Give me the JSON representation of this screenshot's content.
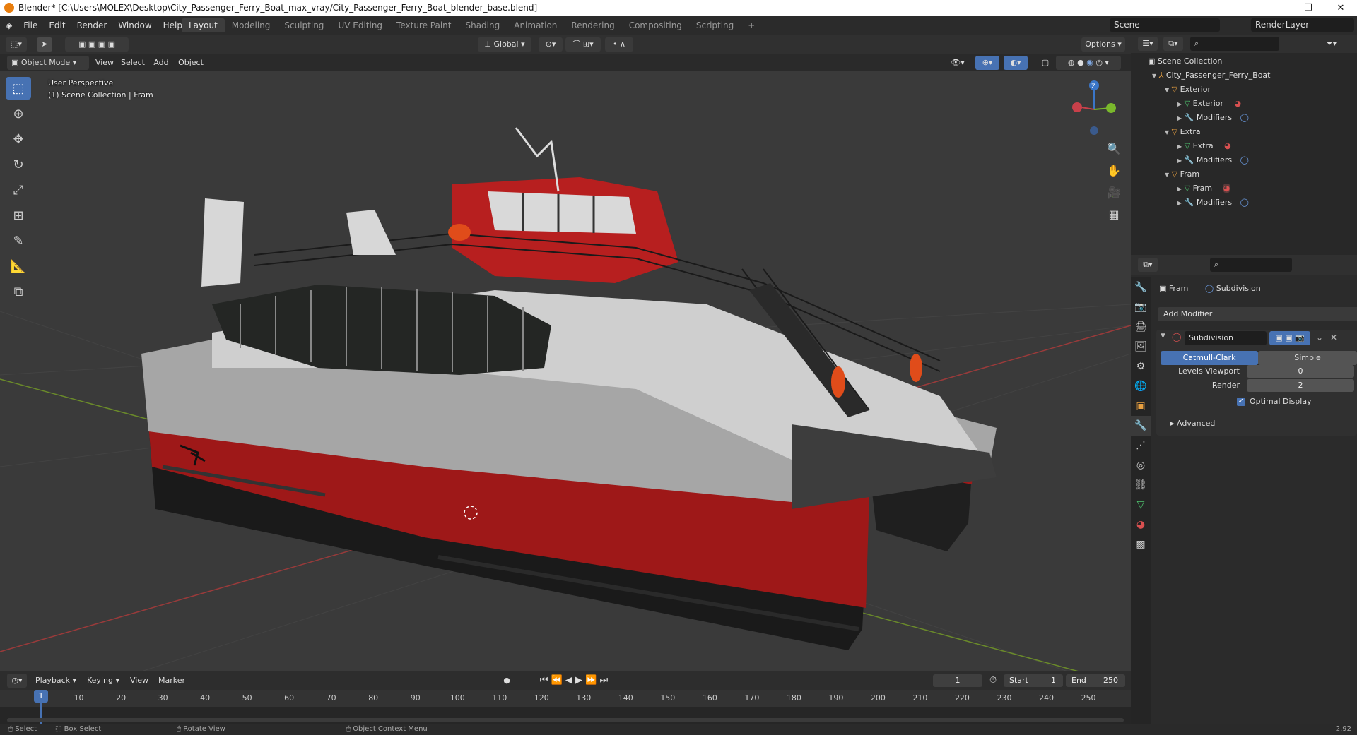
{
  "window": {
    "title": "Blender* [C:\\Users\\MOLEX\\Desktop\\City_Passenger_Ferry_Boat_max_vray/City_Passenger_Ferry_Boat_blender_base.blend]",
    "minimize": "—",
    "maximize": "❐",
    "close": "✕"
  },
  "menu": [
    "File",
    "Edit",
    "Render",
    "Window",
    "Help"
  ],
  "workspaces": [
    "Layout",
    "Modeling",
    "Sculpting",
    "UV Editing",
    "Texture Paint",
    "Shading",
    "Animation",
    "Rendering",
    "Compositing",
    "Scripting"
  ],
  "scene": "Scene",
  "render_layer": "RenderLayer",
  "header": {
    "orientation": "Global",
    "options": "Options"
  },
  "viewport_header": {
    "mode": "Object Mode",
    "view": "View",
    "select": "Select",
    "add": "Add",
    "object": "Object"
  },
  "viewport": {
    "perspective": "User Perspective",
    "collection": "(1) Scene Collection | Fram",
    "gizmo_z": "Z"
  },
  "outliner": {
    "root": "Scene Collection",
    "collection": "City_Passenger_Ferry_Boat",
    "items": [
      {
        "name": "Exterior",
        "child": "Exterior",
        "mods": "Modifiers"
      },
      {
        "name": "Extra",
        "child": "Extra",
        "mods": "Modifiers"
      },
      {
        "name": "Fram",
        "child": "Fram",
        "mods": "Modifiers"
      }
    ]
  },
  "properties": {
    "object": "Fram",
    "modifier_tab": "Subdivision",
    "add_modifier": "Add Modifier",
    "modifier_name": "Subdivision",
    "catmull": "Catmull-Clark",
    "simple": "Simple",
    "levels_label": "Levels Viewport",
    "levels_value": "0",
    "render_label": "Render",
    "render_value": "2",
    "optimal": "Optimal Display",
    "advanced": "Advanced"
  },
  "timeline": {
    "playback": "Playback",
    "keying": "Keying",
    "view": "View",
    "marker": "Marker",
    "current_frame": "1",
    "start_label": "Start",
    "start": "1",
    "end_label": "End",
    "end": "250",
    "ticks": [
      "1",
      "10",
      "20",
      "30",
      "40",
      "50",
      "60",
      "70",
      "80",
      "90",
      "100",
      "110",
      "120",
      "130",
      "140",
      "150",
      "160",
      "170",
      "180",
      "190",
      "200",
      "210",
      "220",
      "230",
      "240",
      "250"
    ]
  },
  "status": {
    "select": "Select",
    "box": "Box Select",
    "rotate": "Rotate View",
    "context": "Object Context Menu",
    "version": "2.92"
  },
  "colors": {
    "accent": "#4772b3",
    "hull_red": "#a81c1c",
    "orange": "#e87d0d"
  }
}
